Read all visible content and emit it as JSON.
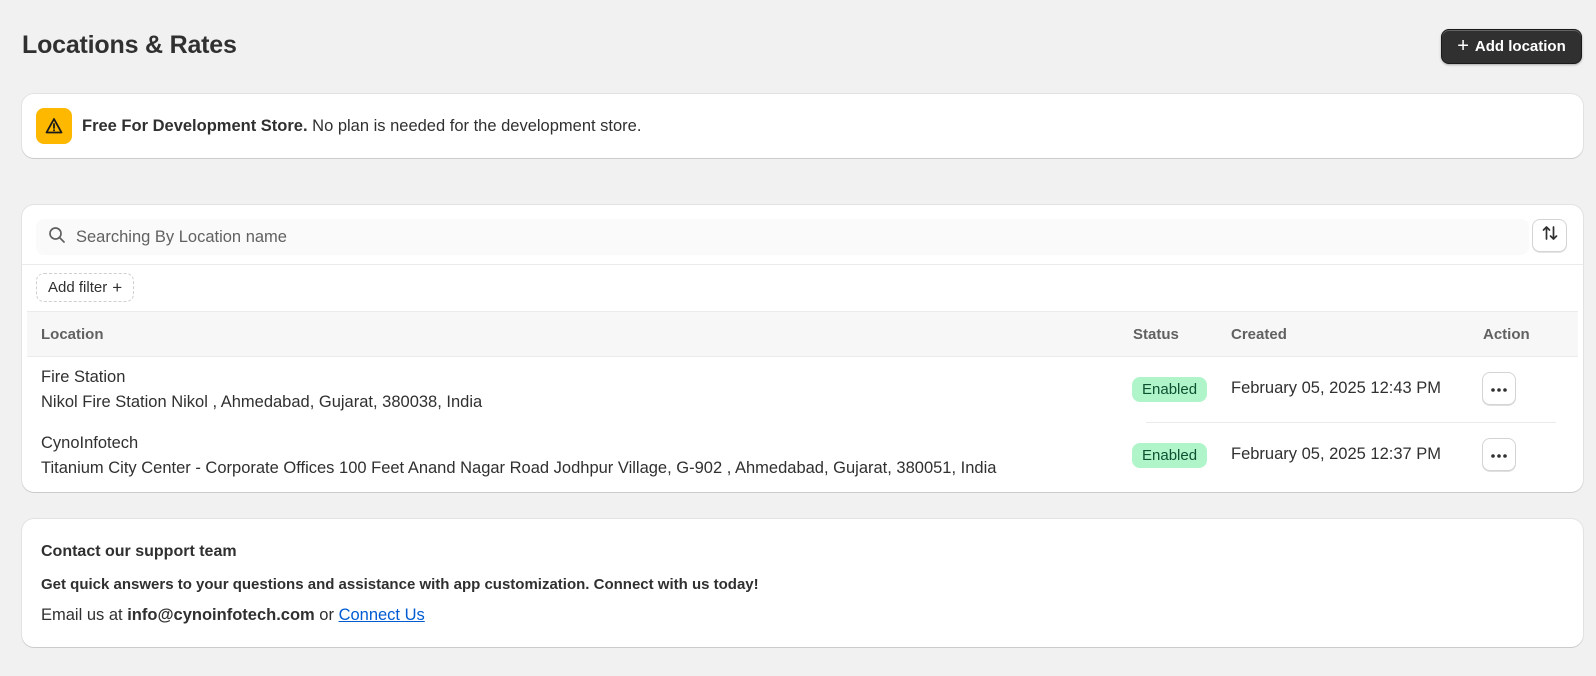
{
  "header": {
    "title": "Locations & Rates",
    "add_location_label": "Add location"
  },
  "banner": {
    "bold_text": "Free For Development Store.",
    "text": " No plan is needed for the development store.",
    "icon": "warning-triangle-icon",
    "accent_color": "#ffb800"
  },
  "search": {
    "placeholder": "Searching By Location name",
    "value": ""
  },
  "filter": {
    "add_filter_label": "Add filter"
  },
  "table": {
    "columns": [
      "Location",
      "Status",
      "Created",
      "Action"
    ],
    "rows": [
      {
        "name": "Fire Station",
        "address": "Nikol Fire Station Nikol , Ahmedabad, Gujarat, 380038, India",
        "status": "Enabled",
        "created": "February 05, 2025 12:43 PM"
      },
      {
        "name": "CynoInfotech",
        "address": "Titanium City Center - Corporate Offices 100 Feet Anand Nagar Road Jodhpur Village, G-902 , Ahmedabad, Gujarat, 380051, India",
        "status": "Enabled",
        "created": "February 05, 2025 12:37 PM"
      }
    ],
    "status_color": "#aff5c9"
  },
  "support": {
    "title": "Contact our support team",
    "description": "Get quick answers to your questions and assistance with app customization. Connect with us today!",
    "email_prefix": "Email us at ",
    "email": "info@cynoinfotech.com",
    "or_text": " or ",
    "link_label": "Connect Us",
    "link_color": "#005bd3"
  }
}
